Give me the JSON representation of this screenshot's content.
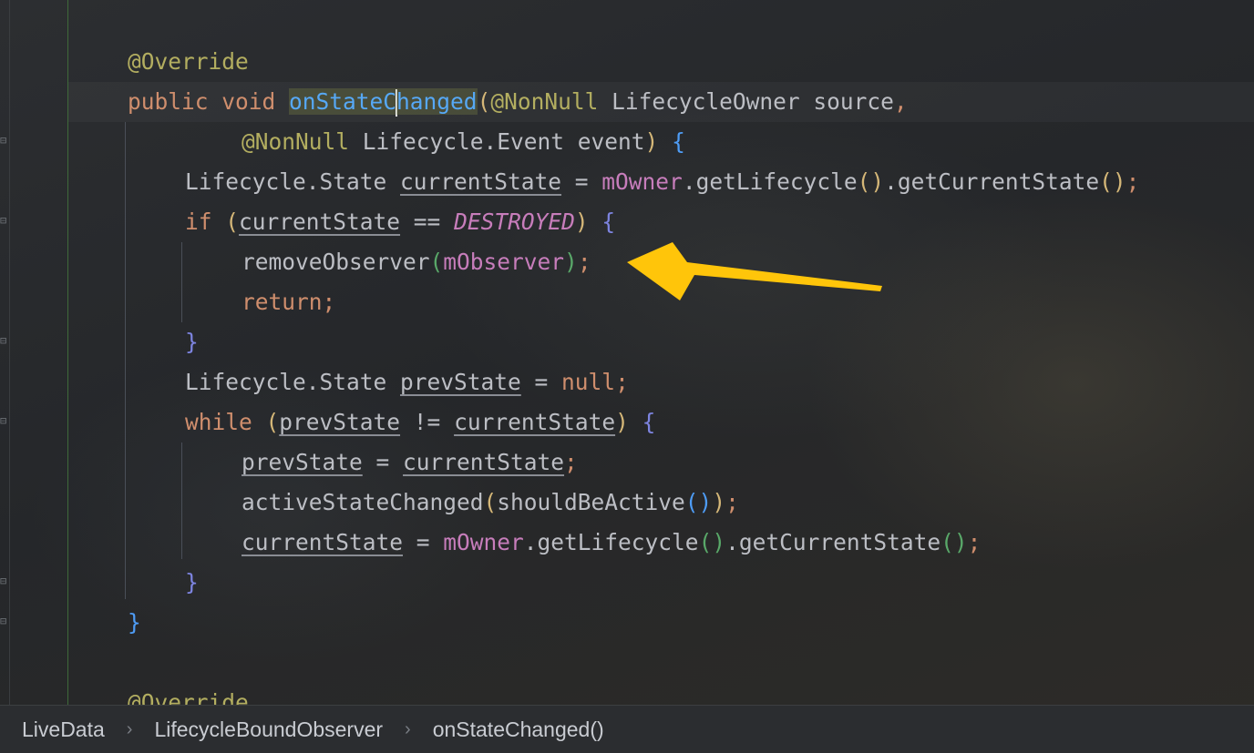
{
  "editor": {
    "lines": [
      {
        "indent": 140,
        "tokens": [
          {
            "t": "@Override",
            "c": "ann"
          }
        ]
      },
      {
        "indent": 140,
        "tokens": [
          {
            "t": "public ",
            "c": "kw"
          },
          {
            "t": "void ",
            "c": "kw"
          },
          {
            "t": "onStateC",
            "c": "fn sel"
          },
          {
            "t": "",
            "c": "caret"
          },
          {
            "t": "hanged",
            "c": "fn sel"
          },
          {
            "t": "(",
            "c": "p1"
          },
          {
            "t": "@NonNull ",
            "c": "ann"
          },
          {
            "t": "LifecycleOwner source",
            "c": "punc"
          },
          {
            "t": ",",
            "c": "kw"
          }
        ]
      },
      {
        "indent": 265,
        "tokens": [
          {
            "t": "@NonNull ",
            "c": "ann"
          },
          {
            "t": "Lifecycle.Event event",
            "c": "punc"
          },
          {
            "t": ")",
            "c": "p1"
          },
          {
            "t": " ",
            "c": "punc"
          },
          {
            "t": "{",
            "c": "br1"
          }
        ]
      },
      {
        "indent": 203,
        "tokens": [
          {
            "t": "Lifecycle.State ",
            "c": "punc"
          },
          {
            "t": "currentState",
            "c": "var"
          },
          {
            "t": " = ",
            "c": "punc"
          },
          {
            "t": "mOwner",
            "c": "field"
          },
          {
            "t": ".getLifecycle",
            "c": "punc"
          },
          {
            "t": "()",
            "c": "p1"
          },
          {
            "t": ".getCurrentState",
            "c": "punc"
          },
          {
            "t": "()",
            "c": "p1"
          },
          {
            "t": ";",
            "c": "kw"
          }
        ]
      },
      {
        "indent": 203,
        "tokens": [
          {
            "t": "if ",
            "c": "kw"
          },
          {
            "t": "(",
            "c": "p1"
          },
          {
            "t": "currentState",
            "c": "var"
          },
          {
            "t": " == ",
            "c": "punc"
          },
          {
            "t": "DESTROYED",
            "c": "const"
          },
          {
            "t": ")",
            "c": "p1"
          },
          {
            "t": " ",
            "c": "punc"
          },
          {
            "t": "{",
            "c": "br2"
          }
        ]
      },
      {
        "indent": 265,
        "tokens": [
          {
            "t": "removeObserver",
            "c": "punc"
          },
          {
            "t": "(",
            "c": "p4"
          },
          {
            "t": "mObserver",
            "c": "field"
          },
          {
            "t": ")",
            "c": "p4"
          },
          {
            "t": ";",
            "c": "kw"
          }
        ]
      },
      {
        "indent": 265,
        "tokens": [
          {
            "t": "return",
            "c": "kw"
          },
          {
            "t": ";",
            "c": "kw"
          }
        ]
      },
      {
        "indent": 203,
        "tokens": [
          {
            "t": "}",
            "c": "br2"
          }
        ]
      },
      {
        "indent": 203,
        "tokens": [
          {
            "t": "Lifecycle.State ",
            "c": "punc"
          },
          {
            "t": "prevState",
            "c": "var"
          },
          {
            "t": " = ",
            "c": "punc"
          },
          {
            "t": "null",
            "c": "kw"
          },
          {
            "t": ";",
            "c": "kw"
          }
        ]
      },
      {
        "indent": 203,
        "tokens": [
          {
            "t": "while ",
            "c": "kw"
          },
          {
            "t": "(",
            "c": "p1"
          },
          {
            "t": "prevState",
            "c": "var"
          },
          {
            "t": " != ",
            "c": "punc"
          },
          {
            "t": "currentState",
            "c": "var"
          },
          {
            "t": ")",
            "c": "p1"
          },
          {
            "t": " ",
            "c": "punc"
          },
          {
            "t": "{",
            "c": "br2"
          }
        ]
      },
      {
        "indent": 265,
        "tokens": [
          {
            "t": "prevState",
            "c": "var"
          },
          {
            "t": " = ",
            "c": "punc"
          },
          {
            "t": "currentState",
            "c": "var"
          },
          {
            "t": ";",
            "c": "kw"
          }
        ]
      },
      {
        "indent": 265,
        "tokens": [
          {
            "t": "activeStateChanged",
            "c": "punc"
          },
          {
            "t": "(",
            "c": "p1"
          },
          {
            "t": "shouldBeActive",
            "c": "punc"
          },
          {
            "t": "()",
            "c": "p3"
          },
          {
            "t": ")",
            "c": "p1"
          },
          {
            "t": ";",
            "c": "kw"
          }
        ]
      },
      {
        "indent": 265,
        "tokens": [
          {
            "t": "currentState",
            "c": "var"
          },
          {
            "t": " = ",
            "c": "punc"
          },
          {
            "t": "mOwner",
            "c": "field"
          },
          {
            "t": ".getLifecycle",
            "c": "punc"
          },
          {
            "t": "()",
            "c": "p4"
          },
          {
            "t": ".getCurrentState",
            "c": "punc"
          },
          {
            "t": "()",
            "c": "p4"
          },
          {
            "t": ";",
            "c": "kw"
          }
        ]
      },
      {
        "indent": 203,
        "tokens": [
          {
            "t": "}",
            "c": "br2"
          }
        ]
      },
      {
        "indent": 140,
        "tokens": [
          {
            "t": "}",
            "c": "br1"
          }
        ]
      },
      {
        "indent": 140,
        "tokens": []
      },
      {
        "indent": 140,
        "tokens": [
          {
            "t": "@Override",
            "c": "ann"
          }
        ]
      }
    ],
    "annotation_arrow_color": "#ffc50a"
  },
  "breadcrumb": {
    "items": [
      "LiveData",
      "LifecycleBoundObserver",
      "onStateChanged()"
    ],
    "separator": "›"
  },
  "colors": {
    "background": "#26282b",
    "keyword": "#cf8e6d",
    "annotation": "#b3ae60",
    "method_decl": "#56a8f5",
    "field": "#c77dbb"
  }
}
